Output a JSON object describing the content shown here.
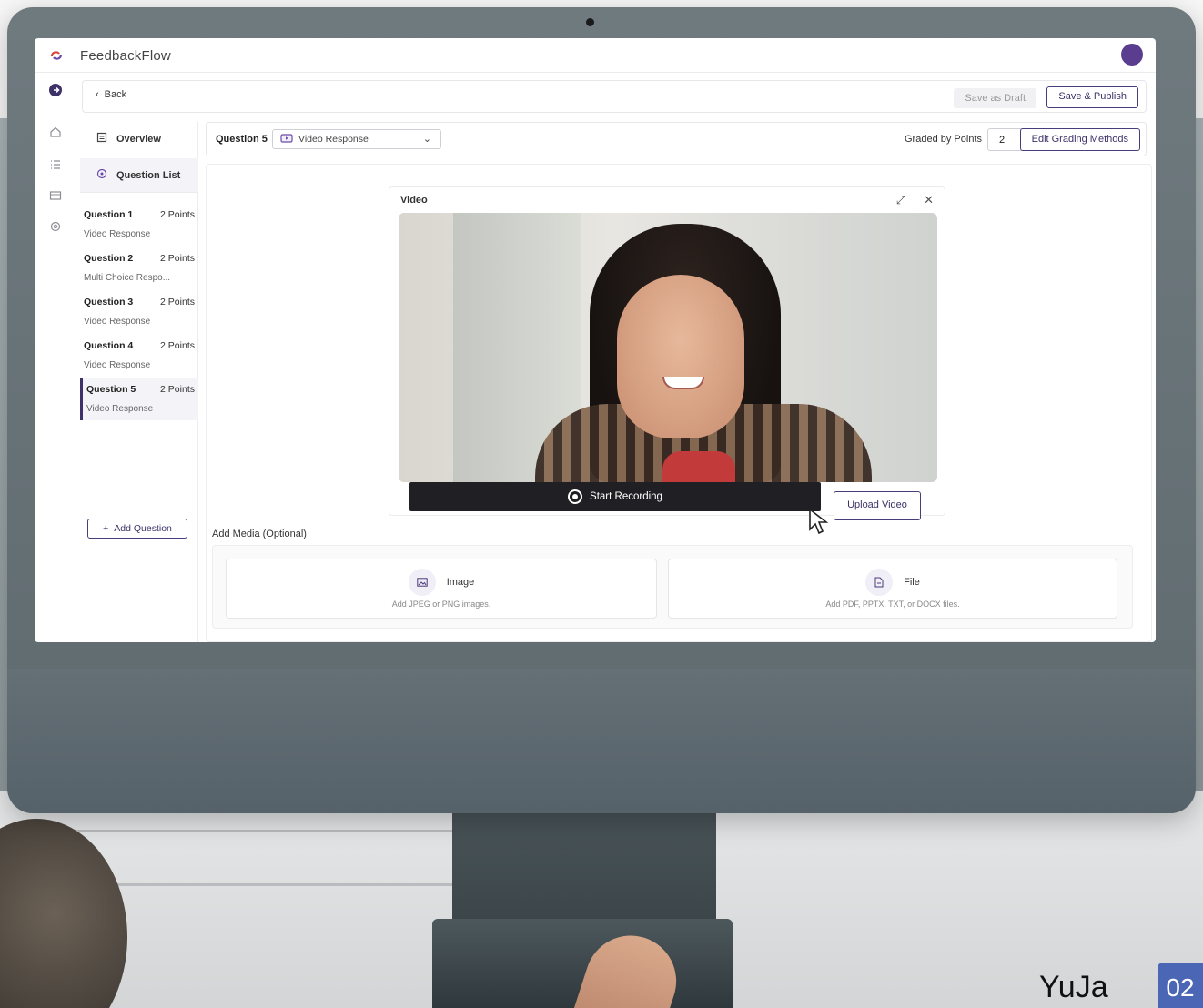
{
  "app": {
    "title": "FeedbackFlow"
  },
  "header": {
    "back_label": "Back",
    "save_draft_label": "Save as Draft",
    "save_publish_label": "Save & Publish"
  },
  "left_panel": {
    "overview_label": "Overview",
    "question_list_label": "Question List",
    "questions": [
      {
        "title": "Question 1",
        "points": "2 Points",
        "type": "Video Response"
      },
      {
        "title": "Question 2",
        "points": "2 Points",
        "type": "Multi Choice Respo..."
      },
      {
        "title": "Question 3",
        "points": "2 Points",
        "type": "Video Response"
      },
      {
        "title": "Question 4",
        "points": "2 Points",
        "type": "Video Response"
      },
      {
        "title": "Question 5",
        "points": "2 Points",
        "type": "Video Response"
      }
    ],
    "add_question_label": "Add Question"
  },
  "question_bar": {
    "label": "Question 5",
    "type_selected": "Video Response",
    "graded_label": "Graded by Points",
    "graded_value": "2",
    "edit_grading_label": "Edit Grading Methods"
  },
  "video": {
    "title": "Video",
    "start_recording_label": "Start Recording",
    "upload_label": "Upload Video"
  },
  "media": {
    "label": "Add Media (Optional)",
    "image": {
      "label": "Image",
      "hint": "Add JPEG or PNG images."
    },
    "file": {
      "label": "File",
      "hint": "Add PDF, PPTX, TXT, or DOCX files."
    }
  },
  "brand": {
    "name": "YuJa",
    "page": "02"
  },
  "colors": {
    "accent": "#3d3168",
    "avatar": "#5b3d8f",
    "badge": "#4a66b4"
  }
}
